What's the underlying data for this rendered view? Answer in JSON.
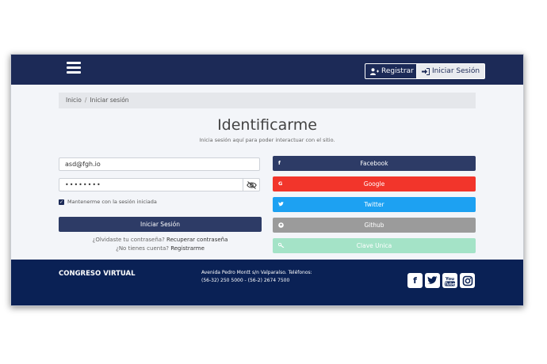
{
  "header": {
    "register_label": "Registrar",
    "login_label": "Iniciar Sesión",
    "register_icon": "user-plus-icon",
    "login_icon": "sign-in-icon"
  },
  "breadcrumb": {
    "home": "Inicio",
    "separator": "/",
    "current": "Iniciar sesión"
  },
  "login": {
    "title": "Identificarme",
    "subtitle": "Inicia sesión aquí para poder interactuar con el sitio.",
    "email_value": "asd@fgh.io",
    "password_value": "••••••••",
    "remember_label": "Mantenerme con la sesión iniciada",
    "remember_checked": true,
    "submit_label": "Iniciar Sesión",
    "forgot_prefix": "¿Olvidaste tu contraseña?",
    "forgot_link": "Recuperar contraseña",
    "noaccount_prefix": "¿No tienes cuenta?",
    "register_link": "Registrarme"
  },
  "social": [
    {
      "label": "Facebook",
      "icon": "f",
      "color": "#2d3b66"
    },
    {
      "label": "Google",
      "icon": "G",
      "color": "#f2352b"
    },
    {
      "label": "Twitter",
      "icon": "t",
      "color": "#1da1f2"
    },
    {
      "label": "Github",
      "icon": "gh",
      "color": "#9b9b9b"
    },
    {
      "label": "Clave Unica",
      "icon": "key",
      "color": "#a4e3c7"
    }
  ],
  "footer": {
    "name": "CONGRESO VIRTUAL",
    "address_line1": "Avenida Pedro Montt s/n Valparaíso. Teléfonos:",
    "address_line2": "(56-32) 250 5000 - (56-2) 2674 7500",
    "icons": [
      "facebook-icon",
      "twitter-icon",
      "youtube-icon",
      "instagram-icon"
    ]
  },
  "colors": {
    "navbar": "#1c2a57",
    "footer": "#0a2155",
    "background": "#f3f5f9"
  }
}
